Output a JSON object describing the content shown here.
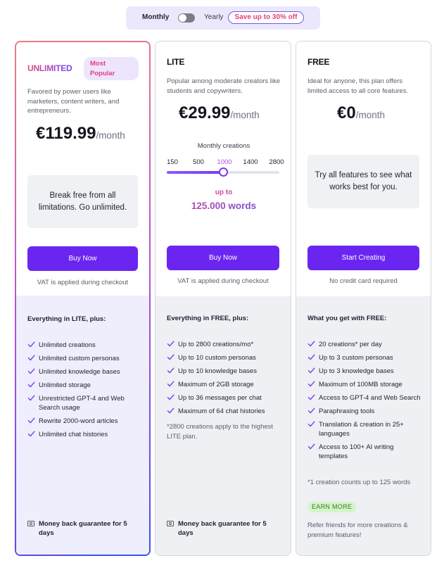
{
  "billing": {
    "monthly_label": "Monthly",
    "yearly_label": "Yearly",
    "save_badge": "Save up to 30% off",
    "selected": "Monthly"
  },
  "colors": {
    "primary_button": "#6a26f0",
    "accent_pink": "#e5407a",
    "accent_purple": "#7c3aed"
  },
  "plans": {
    "unlimited": {
      "name": "UNLIMITED",
      "badge": "Most Popular",
      "description": "Favored by power users like marketers, content writers, and entrepreneurs.",
      "price": "€119.99",
      "period": "/month",
      "promo": "Break free from all limitations. Go unlimited.",
      "cta": "Buy Now",
      "note": "VAT is applied during checkout",
      "features_title": "Everything in LITE, plus:",
      "features": [
        "Unlimited creations",
        "Unlimited custom personas",
        "Unlimited knowledge bases",
        "Unlimited storage",
        "Unrestricted GPT-4 and Web Search usage",
        "Rewrite 2000-word articles",
        "Unlimited chat histories"
      ],
      "guarantee": "Money back guarantee for 5 days"
    },
    "lite": {
      "name": "LITE",
      "description": "Popular among moderate creators like students and copywriters.",
      "price": "€29.99",
      "period": "/month",
      "slider": {
        "title": "Monthly creations",
        "ticks": [
          "150",
          "500",
          "1000",
          "1400",
          "2800"
        ],
        "selected": "1000",
        "selected_fraction": 0.5
      },
      "up_to_label": "up to",
      "words": "125.000 words",
      "cta": "Buy Now",
      "note": "VAT is applied during checkout",
      "features_title": "Everything in FREE, plus:",
      "features": [
        "Up to 2800 creations/mo*",
        "Up to 10 custom personas",
        "Up to 10 knowledge bases",
        "Maximum of 2GB storage",
        "Up to 36 messages per chat",
        "Maximum of 64 chat histories"
      ],
      "footnote": "*2800 creations apply to the highest LITE plan.",
      "guarantee": "Money back guarantee for 5 days"
    },
    "free": {
      "name": "FREE",
      "description": "Ideal for anyone, this plan offers limited access to all core features.",
      "price": "€0",
      "period": "/month",
      "promo": "Try all features to see what works best for you.",
      "cta": "Start Creating",
      "note": "No credit card required",
      "features_title": "What you get with FREE:",
      "features": [
        "20 creations* per day",
        "Up to 3 custom personas",
        "Up to 3 knowledge bases",
        "Maximum of 100MB storage",
        "Access to GPT-4 and Web Search",
        "Paraphrasing tools",
        "Translation & creation in 25+ languages",
        "Access to 100+ AI writing templates"
      ],
      "footnote": "*1 creation counts up to 125 words",
      "earn_badge": "EARN MORE",
      "refer_text": "Refer friends for more creations & premium features!"
    }
  }
}
